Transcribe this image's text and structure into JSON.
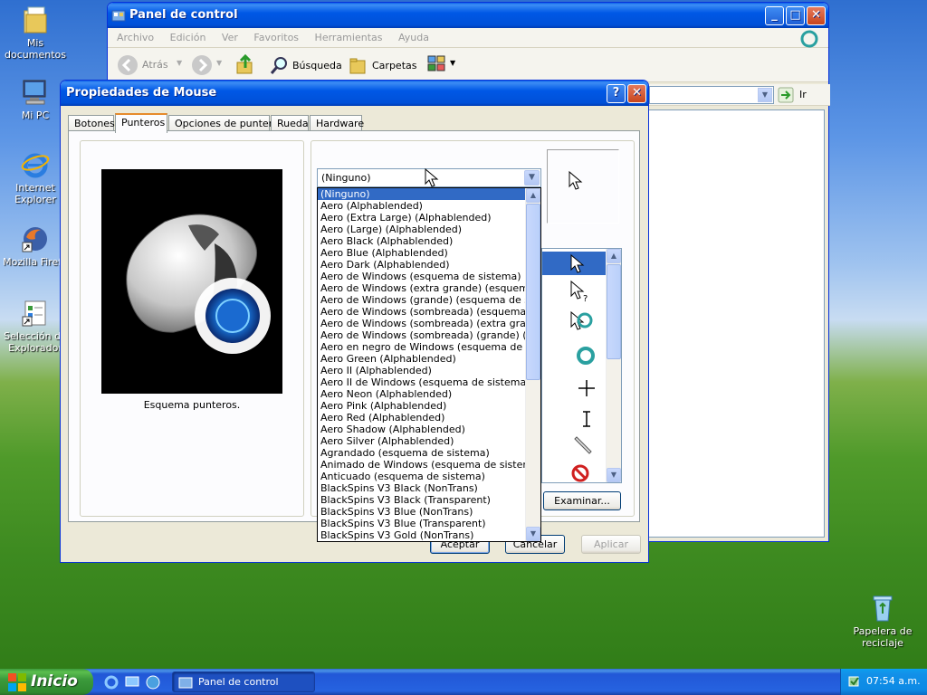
{
  "desktop": {
    "icons": [
      {
        "label": "Mis documentos"
      },
      {
        "label": "Mi PC"
      },
      {
        "label": "Internet Explorer"
      },
      {
        "label": "Mozilla Firefo"
      },
      {
        "label": "Selección de Explorador"
      },
      {
        "label": "Papelera de reciclaje"
      }
    ]
  },
  "control_panel": {
    "title": "Panel de control",
    "menu": [
      "Archivo",
      "Edición",
      "Ver",
      "Favoritos",
      "Herramientas",
      "Ayuda"
    ],
    "toolbar": {
      "back": "Atrás",
      "search": "Búsqueda",
      "folders": "Carpetas"
    },
    "address_go": "Ir"
  },
  "mouse_dialog": {
    "title": "Propiedades de Mouse",
    "tabs": [
      "Botones",
      "Punteros",
      "Opciones de puntero",
      "Rueda",
      "Hardware"
    ],
    "active_tab": "Punteros",
    "preview_caption": "Esquema punteros.",
    "scheme_selected": "(Ninguno)",
    "scheme_options": [
      "(Ninguno)",
      "Aero (Alphablended)",
      "Aero (Extra Large) (Alphablended)",
      "Aero (Large) (Alphablended)",
      "Aero Black (Alphablended)",
      "Aero Blue (Alphablended)",
      "Aero Dark (Alphablended)",
      "Aero de Windows (esquema de sistema)",
      "Aero de Windows (extra grande) (esquema de sis",
      "Aero de Windows (grande) (esquema de sistema",
      "Aero de Windows (sombreada) (esquema de sist",
      "Aero de Windows (sombreada) (extra grande) (es",
      "Aero de Windows (sombreada) (grande) (esquem",
      "Aero en negro de Windows (esquema de sistema",
      "Aero Green (Alphablended)",
      "Aero II (Alphablended)",
      "Aero II de Windows (esquema de sistema)",
      "Aero Neon (Alphablended)",
      "Aero Pink (Alphablended)",
      "Aero Red (Alphablended)",
      "Aero Shadow (Alphablended)",
      "Aero Silver (Alphablended)",
      "Agrandado (esquema de sistema)",
      "Animado de Windows (esquema de sistema)",
      "Anticuado (esquema de sistema)",
      "BlackSpins V3 Black (NonTrans)",
      "BlackSpins V3 Black (Transparent)",
      "BlackSpins V3 Blue (NonTrans)",
      "BlackSpins V3 Blue (Transparent)",
      "BlackSpins V3 Gold (NonTrans)"
    ],
    "browse_button": "Examinar...",
    "ok_button": "Aceptar",
    "cancel_button": "Cancelar",
    "apply_button": "Aplicar"
  },
  "taskbar": {
    "start_label": "Inicio",
    "task_label": "Panel de control",
    "clock": "07:54 a.m."
  },
  "colors": {
    "xp_blue": "#0058e6",
    "selection": "#316ac5",
    "start_green": "#3c9a3c"
  }
}
